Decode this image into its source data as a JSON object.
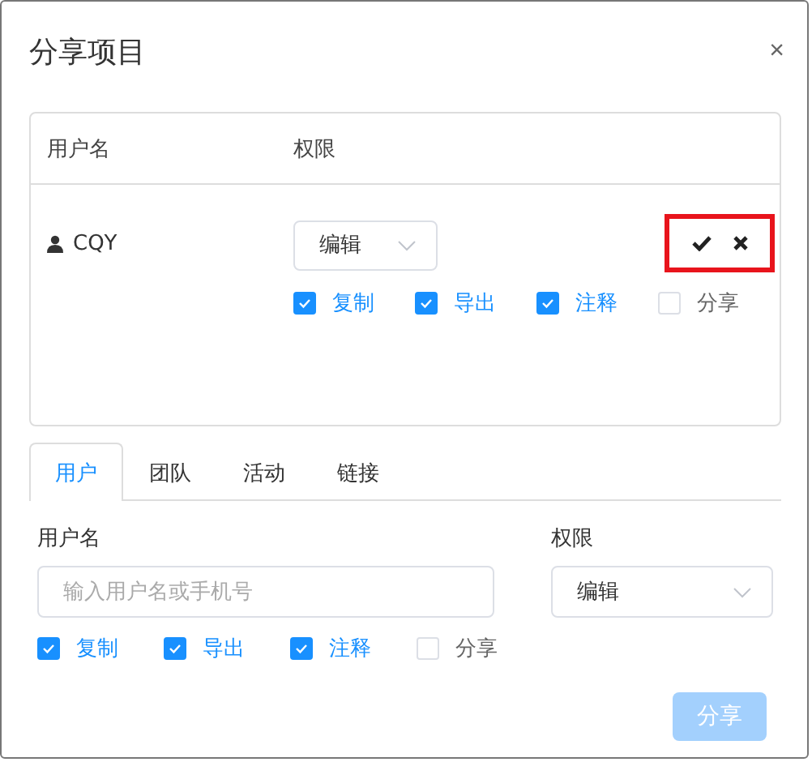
{
  "dialog": {
    "title": "分享项目",
    "close": "×"
  },
  "table": {
    "columns": [
      "用户名",
      "权限"
    ],
    "rows": [
      {
        "user": "CQY",
        "permission": "编辑",
        "highlighted": true,
        "options": [
          {
            "label": "复制",
            "checked": true
          },
          {
            "label": "导出",
            "checked": true
          },
          {
            "label": "注释",
            "checked": true
          },
          {
            "label": "分享",
            "checked": false
          }
        ]
      }
    ]
  },
  "tabs": [
    {
      "label": "用户",
      "selected": true
    },
    {
      "label": "团队",
      "selected": false
    },
    {
      "label": "活动",
      "selected": false
    },
    {
      "label": "链接",
      "selected": false
    }
  ],
  "form": {
    "user_label": "用户名",
    "user_placeholder": "输入用户名或手机号",
    "permission_label": "权限",
    "permission": "编辑",
    "options": [
      {
        "label": "复制",
        "checked": true
      },
      {
        "label": "导出",
        "checked": true
      },
      {
        "label": "注释",
        "checked": true
      },
      {
        "label": "分享",
        "checked": false
      }
    ],
    "submit": {
      "label": "分享",
      "disabled": true
    }
  }
}
